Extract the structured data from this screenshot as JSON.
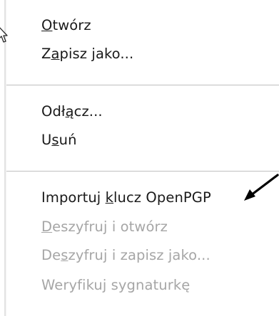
{
  "menu": {
    "items": [
      {
        "label": "Otwórz",
        "mnemonic": "O",
        "enabled": true
      },
      {
        "label": "Zapisz jako...",
        "mnemonic": "a",
        "enabled": true
      },
      {
        "label": "Odłącz...",
        "mnemonic": "ą",
        "enabled": true
      },
      {
        "label": "Usuń",
        "mnemonic": "s",
        "enabled": true
      },
      {
        "label": "Importuj klucz OpenPGP",
        "mnemonic": "k",
        "enabled": true
      },
      {
        "label": "Deszyfruj i otwórz",
        "mnemonic": "D",
        "enabled": false
      },
      {
        "label": "Deszyfruj i zapisz jako...",
        "mnemonic": "s",
        "enabled": false
      },
      {
        "label": "Weryfikuj sygnaturkę",
        "mnemonic": "",
        "enabled": false
      }
    ]
  },
  "icons": {
    "cursor": "mouse-pointer-icon",
    "annotation": "annotation-arrow-icon"
  },
  "colors": {
    "text_enabled": "#1a1a1a",
    "text_disabled": "#a6a6a6",
    "separator": "#bfbfbf",
    "background": "#ffffff",
    "annotation_arrow": "#000000"
  }
}
